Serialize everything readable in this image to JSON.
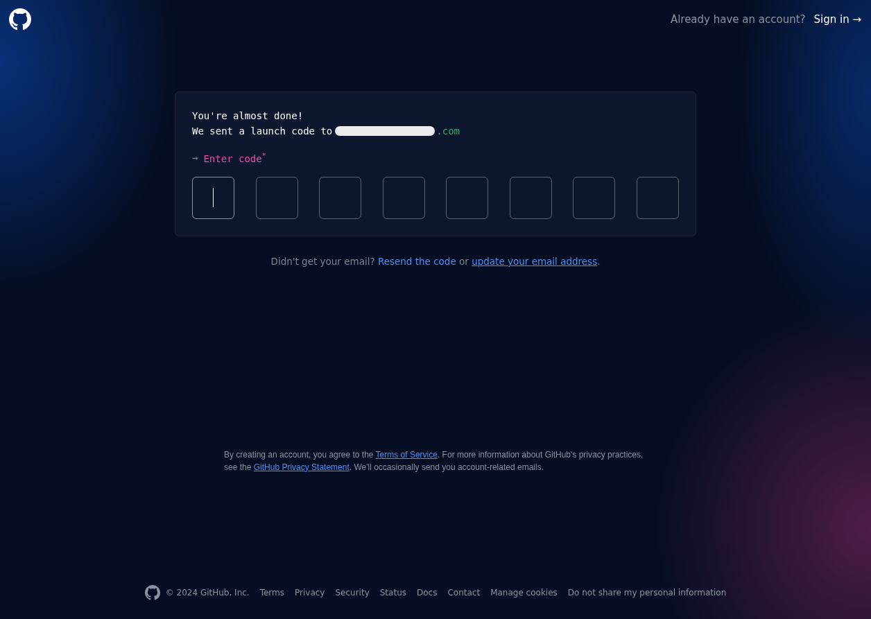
{
  "header": {
    "prompt": "Already have an account?",
    "sign_in": "Sign in →"
  },
  "card": {
    "title": "You're almost done!",
    "sent_text": "We sent a launch code to",
    "email_redacted": true,
    "email_visible": ".com",
    "label_arrow": "→",
    "label": "Enter code",
    "required_mark": "*",
    "code_boxes": [
      {
        "focused": true
      },
      {
        "focused": false
      },
      {
        "focused": false
      },
      {
        "focused": false
      },
      {
        "focused": false
      },
      {
        "focused": false
      },
      {
        "focused": false
      },
      {
        "focused": false
      }
    ]
  },
  "help": [
    {
      "kind": "text",
      "text": "Didn't get your email? "
    },
    {
      "kind": "link",
      "text": "Resend the code"
    },
    {
      "kind": "text",
      "text": " or "
    },
    {
      "kind": "underlined_link",
      "text": "update your email address"
    },
    {
      "kind": "text",
      "text": "."
    }
  ],
  "notice": [
    {
      "kind": "text",
      "text": "By creating an account, you agree to the "
    },
    {
      "kind": "underlined_link",
      "text": "Terms of Service"
    },
    {
      "kind": "text",
      "text": ". For more information about GitHub's privacy practices, see the "
    },
    {
      "kind": "underlined_link",
      "text": "GitHub Privacy Statement"
    },
    {
      "kind": "text",
      "text": ". We'll occasionally send you account-related emails."
    }
  ],
  "footer": {
    "copyright": "© 2024 GitHub, Inc.",
    "links": [
      "Terms",
      "Privacy",
      "Security",
      "Status",
      "Docs",
      "Contact",
      "Manage cookies",
      "Do not share my personal information"
    ]
  }
}
